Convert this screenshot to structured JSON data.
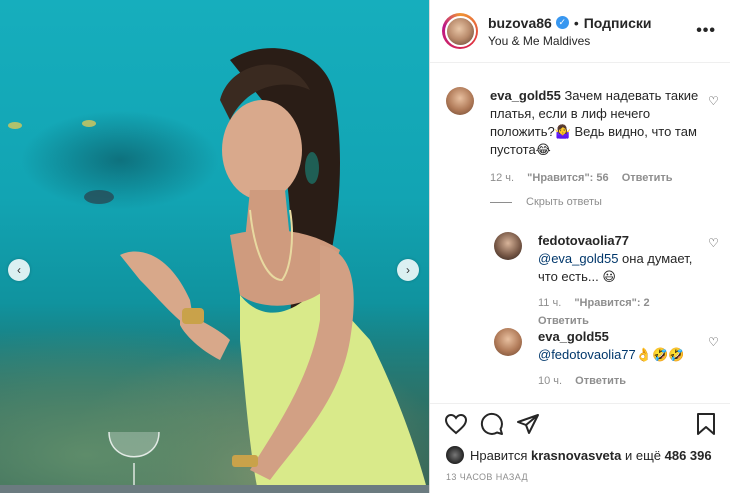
{
  "header": {
    "username": "buzova86",
    "follow_label": "Подписки",
    "location": "You & Me Maldives",
    "more_label": "•••"
  },
  "comments": [
    {
      "username": "eva_gold55",
      "text": "Зачем надевать такие платья, если в лиф нечего положить?🤷‍♀️ Ведь видно, что там пустота😂",
      "time": "12 ч.",
      "likes": "\"Нравится\": 56",
      "reply_label": "Ответить"
    },
    {
      "username": "fedotovaolia77",
      "mention": "@eva_gold55",
      "text": " она думает, что есть... 😃",
      "time": "11 ч.",
      "likes": "\"Нравится\": 2",
      "reply_label": "Ответить"
    },
    {
      "username": "eva_gold55",
      "mention": "@fedotovaolia77",
      "text": "👌🤣🤣",
      "time": "10 ч.",
      "reply_label": "Ответить"
    }
  ],
  "hide_replies_label": "Скрыть ответы",
  "likes": {
    "prefix": "Нравится",
    "user": "krasnovasveta",
    "suffix": "и ещё",
    "count": "486 396"
  },
  "timestamp": "13 ЧАСОВ НАЗАД",
  "icons": [
    "heart-icon",
    "comment-icon",
    "share-icon",
    "bookmark-icon",
    "chevron-left-icon",
    "chevron-right-icon",
    "verified-icon",
    "more-icon"
  ],
  "colors": {
    "accent_blue": "#3897f0",
    "mention": "#00376b",
    "muted": "#8e8e8e"
  }
}
